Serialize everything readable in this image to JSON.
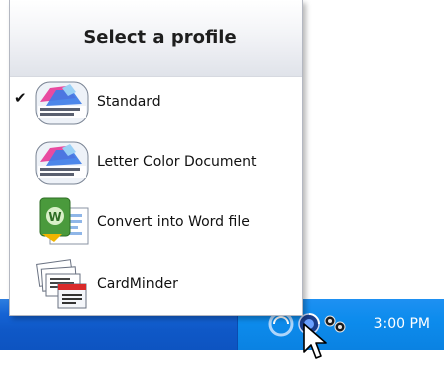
{
  "popup": {
    "title": "Select a profile",
    "items": [
      {
        "label": "Standard",
        "checked": true,
        "check_glyph": "✔",
        "icon": "scansnap-organizer-icon"
      },
      {
        "label": "Letter Color Document",
        "checked": false,
        "icon": "scansnap-organizer-icon"
      },
      {
        "label": "Convert into Word file",
        "checked": false,
        "icon": "word-convert-icon"
      },
      {
        "label": "CardMinder",
        "checked": false,
        "icon": "cardminder-icon"
      }
    ]
  },
  "taskbar": {
    "clock": "3:00 PM",
    "tray_icons": [
      "scansnap-manager-icon",
      "scanner-status-icon",
      "network-icon"
    ]
  },
  "colors": {
    "taskbar": "#0f58c7",
    "tray": "#0d8ced",
    "header_gradient_end": "#e0e3ea"
  }
}
